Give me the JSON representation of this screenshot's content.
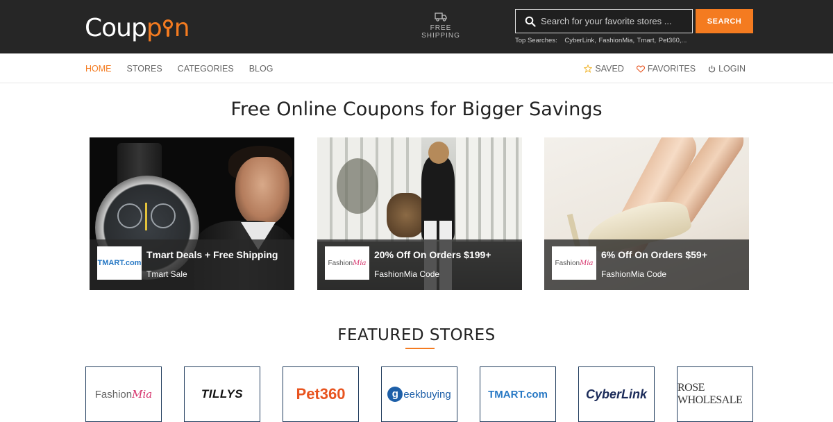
{
  "brand": {
    "name_part1": "Coup",
    "name_part2": "n",
    "accent": "#f47b20"
  },
  "header": {
    "shipping_label": "FREE SHIPPING",
    "search": {
      "placeholder": "Search for your favorite stores ...",
      "button": "SEARCH"
    },
    "top_searches": {
      "label": "Top Searches:",
      "items": [
        "CyberLink,",
        "FashionMia,",
        "Tmart,",
        "Pet360,..."
      ]
    }
  },
  "nav": {
    "left": [
      "HOME",
      "STORES",
      "CATEGORIES",
      "BLOG"
    ],
    "right": {
      "saved": "SAVED",
      "favorites": "FAVORITES",
      "login": "LOGIN"
    }
  },
  "headline": "Free Online Coupons for Bigger Savings",
  "deals": [
    {
      "title": "Tmart Deals + Free Shipping",
      "store": "Tmart Sale",
      "logo": "TMART.com"
    },
    {
      "title": "20% Off On Orders $199+",
      "store": "FashionMia Code",
      "logo": "FashionMia"
    },
    {
      "title": "6% Off On Orders $59+",
      "store": "FashionMia Code",
      "logo": "FashionMia"
    }
  ],
  "featured": {
    "title": "FEATURED STORES",
    "stores": [
      "FashionMia",
      "TILLYS",
      "Pet360",
      "geekbuying",
      "TMART.com",
      "CyberLink",
      "ROSE WHOLESALE"
    ]
  }
}
